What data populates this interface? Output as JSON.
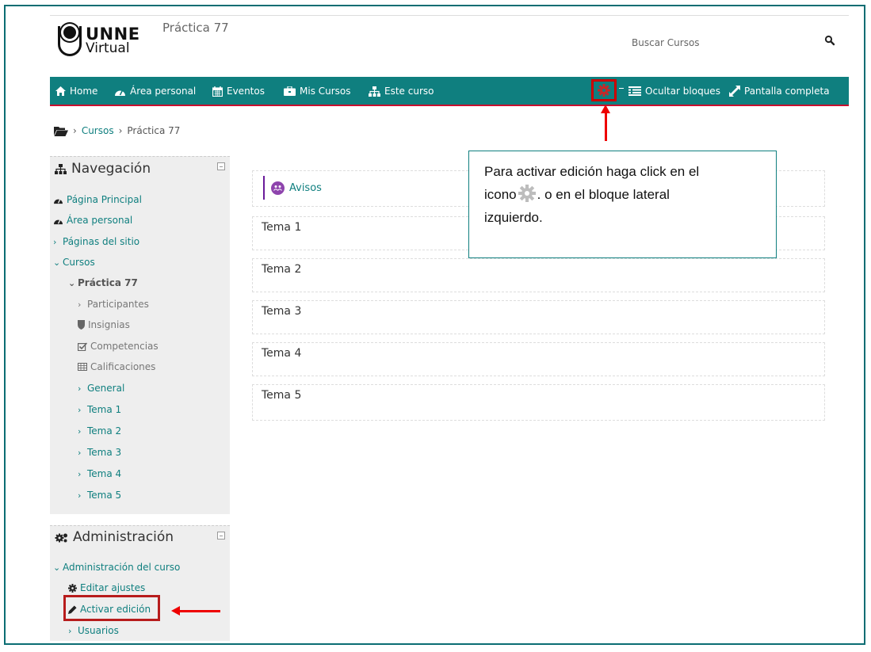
{
  "header": {
    "logo_line1": "UNNE",
    "logo_line2": "Virtual",
    "site_title": "Práctica 77",
    "search_label": "Buscar Cursos"
  },
  "navbar": {
    "items": [
      {
        "label": "Home",
        "icon": "home-icon"
      },
      {
        "label": "Área personal",
        "icon": "dashboard-icon"
      },
      {
        "label": "Eventos",
        "icon": "calendar-icon"
      },
      {
        "label": "Mis Cursos",
        "icon": "briefcase-icon"
      },
      {
        "label": "Este curso",
        "icon": "sitemap-icon"
      }
    ],
    "right_items": [
      {
        "label": "Ocultar bloques",
        "icon": "list-icon"
      },
      {
        "label": "Pantalla completa",
        "icon": "expand-icon"
      }
    ],
    "colors": {
      "bar": "#0f7f7f",
      "accent_border": "#c8102e"
    }
  },
  "breadcrumb": {
    "items": [
      "Cursos",
      "Práctica 77"
    ]
  },
  "callout": {
    "line1": "Para activar edición haga click en el",
    "line2_before": "icono",
    "line2_after": ". o en el bloque lateral",
    "line3": "izquierdo."
  },
  "navigation_block": {
    "title": "Navegación",
    "items": [
      {
        "label": "Página Principal"
      },
      {
        "label": "Área personal"
      },
      {
        "label": "Páginas del sitio"
      },
      {
        "label": "Cursos"
      },
      {
        "label": "Práctica 77"
      },
      {
        "label": "Participantes"
      },
      {
        "label": "Insignias"
      },
      {
        "label": "Competencias"
      },
      {
        "label": "Calificaciones"
      },
      {
        "label": "General"
      },
      {
        "label": "Tema 1"
      },
      {
        "label": "Tema 2"
      },
      {
        "label": "Tema 3"
      },
      {
        "label": "Tema 4"
      },
      {
        "label": "Tema 5"
      }
    ]
  },
  "admin_block": {
    "title": "Administración",
    "items": [
      {
        "label": "Administración del curso"
      },
      {
        "label": "Editar ajustes"
      },
      {
        "label": "Activar edición"
      },
      {
        "label": "Usuarios"
      }
    ]
  },
  "main": {
    "forum": "Avisos",
    "sections": [
      "Tema 1",
      "Tema 2",
      "Tema 3",
      "Tema 4",
      "Tema 5"
    ]
  }
}
